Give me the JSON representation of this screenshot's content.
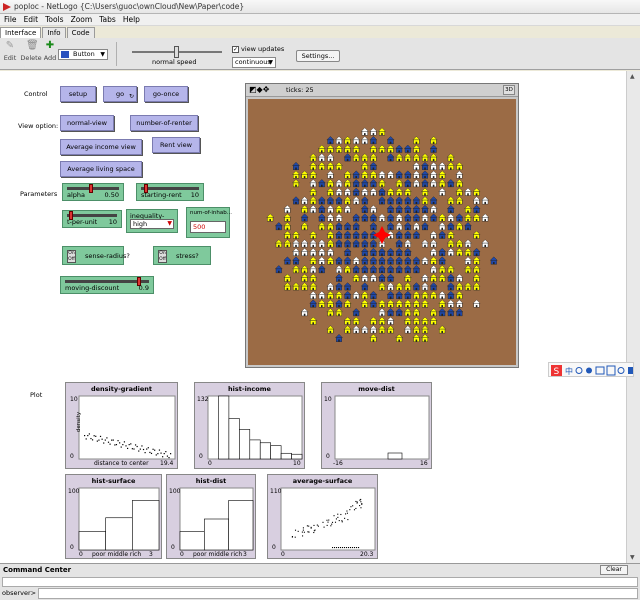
{
  "window": {
    "title": "poploc - NetLogo {C:\\Users\\guoc\\ownCloud\\New\\Paper\\code}"
  },
  "menu": [
    "File",
    "Edit",
    "Tools",
    "Zoom",
    "Tabs",
    "Help"
  ],
  "tabs": [
    "Interface",
    "Info",
    "Code"
  ],
  "toolbar": {
    "edit": "Edit",
    "delete": "Delete",
    "add": "Add",
    "widget_type": "Button",
    "speed_label": "normal speed",
    "view_updates": "view updates",
    "update_mode": "continuous",
    "settings": "Settings..."
  },
  "labels": {
    "control": "Control",
    "view_option": "View option:",
    "parameters": "Parameters",
    "plot": "Plot"
  },
  "buttons": {
    "setup": "setup",
    "go": "go",
    "go_once": "go-once",
    "normal_view": "normal-view",
    "number_of_renter": "number-of-renter",
    "average_income_view": "Average income view",
    "rent_view": "Rent view",
    "average_living_space": "Average living space"
  },
  "sliders": {
    "alpha": {
      "name": "alpha",
      "value": "0.50",
      "fraction": 0.45
    },
    "starting_rent": {
      "name": "starting-rent",
      "value": "10",
      "fraction": 0.05
    },
    "t_per_unit": {
      "name": "t-per-unit",
      "value": "10",
      "fraction": 0.05
    },
    "moving_discount": {
      "name": "moving-discount",
      "value": "0.9",
      "fraction": 0.9
    }
  },
  "chooser": {
    "name": "inequality-level",
    "value": "high"
  },
  "input": {
    "name": "num-of-inhab...",
    "value": "500"
  },
  "switches": {
    "sense_radius": {
      "name": "sense-radius?",
      "on": "On",
      "off": "Off"
    },
    "stress": {
      "name": "stress?",
      "on": "On",
      "off": "Off"
    }
  },
  "world": {
    "ticks": "ticks: 25",
    "three_d": "3D",
    "background": "#9b6b45"
  },
  "colors": {
    "yellow": "#ffff00",
    "blue": "#2048a8",
    "white": "#ffffff",
    "red": "#ff0000"
  },
  "plots": {
    "density_gradient": {
      "title": "density-gradient",
      "ymax": "10",
      "ymin": "0",
      "xmax": "19.4",
      "xlabel": "distance to center",
      "ylabel": "density"
    },
    "hist_income": {
      "title": "hist-income",
      "ymax": "132",
      "ymin": "0",
      "xmin": "0",
      "xmax": "10"
    },
    "move_dist": {
      "title": "move-dist",
      "ymax": "10",
      "ymin": "0",
      "xmin": "-16",
      "xmax": "16"
    },
    "hist_surface": {
      "title": "hist-surface",
      "ymax": "100",
      "ymin": "0",
      "xlabel": "poor middle rich",
      "xmax": "3"
    },
    "hist_dist": {
      "title": "hist-dist",
      "ymax": "100",
      "ymin": "0",
      "xlabel": "poor middle rich",
      "xmax": "3"
    },
    "average_surface": {
      "title": "average-surface",
      "ymax": "110",
      "ymin": "0",
      "xmax": "20.3"
    }
  },
  "command_center": {
    "title": "Command Center",
    "clear": "Clear",
    "observer": "observer>"
  }
}
